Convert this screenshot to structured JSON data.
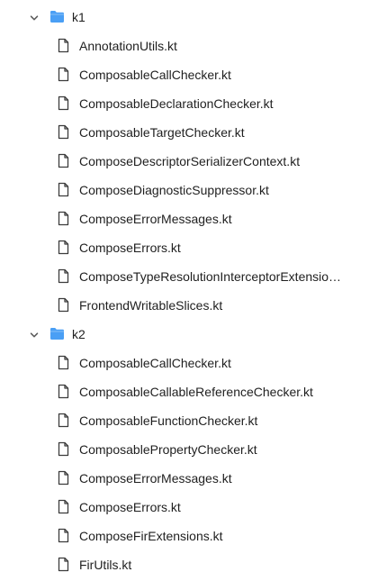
{
  "folders": [
    {
      "name": "k1",
      "expanded": true,
      "files": [
        "AnnotationUtils.kt",
        "ComposableCallChecker.kt",
        "ComposableDeclarationChecker.kt",
        "ComposableTargetChecker.kt",
        "ComposeDescriptorSerializerContext.kt",
        "ComposeDiagnosticSuppressor.kt",
        "ComposeErrorMessages.kt",
        "ComposeErrors.kt",
        "ComposeTypeResolutionInterceptorExtension.kt",
        "FrontendWritableSlices.kt"
      ]
    },
    {
      "name": "k2",
      "expanded": true,
      "files": [
        "ComposableCallChecker.kt",
        "ComposableCallableReferenceChecker.kt",
        "ComposableFunctionChecker.kt",
        "ComposablePropertyChecker.kt",
        "ComposeErrorMessages.kt",
        "ComposeErrors.kt",
        "ComposeFirExtensions.kt",
        "FirUtils.kt"
      ]
    }
  ],
  "icons": {
    "folder": "folder-icon",
    "file": "file-icon",
    "chevron": "chevron-down-icon"
  },
  "colors": {
    "folder": "#4a9ff5",
    "icon_stroke": "#3c3c3c",
    "text": "#1f1f1f"
  }
}
